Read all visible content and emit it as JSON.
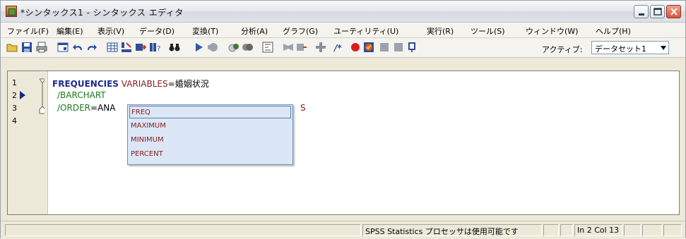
{
  "window": {
    "title": "*シンタックス1 - シンタックス エディタ"
  },
  "menu": {
    "items": [
      "ファイル(F)",
      "編集(E)",
      "表示(V)",
      "データ(D)",
      "変換(T)",
      "分析(A)",
      "グラフ(G)",
      "ユーティリティ(U)",
      "実行(R)",
      "ツール(S)",
      "ウィンドウ(W)",
      "ヘルプ(H)"
    ]
  },
  "toolbar": {
    "active_label": "アクティブ:",
    "dataset_value": "データセット1"
  },
  "editor": {
    "line_numbers": [
      "1",
      "2",
      "3",
      "4"
    ],
    "line1": {
      "command": "FREQUENCIES",
      "subcommand": "VARIABLES",
      "eq": "=",
      "value": "婚姻状況"
    },
    "line2": {
      "text": "/BARCHART"
    },
    "line3": {
      "slash": "/ORDER",
      "eq": "=",
      "partial": "ANA",
      "hidden_tail": "S"
    }
  },
  "autocomplete": {
    "items": [
      "FREQ",
      "MAXIMUM",
      "MINIMUM",
      "PERCENT"
    ]
  },
  "status": {
    "processor": "SPSS Statistics プロセッサは使用可能です",
    "position": "In 2 Col 13"
  }
}
